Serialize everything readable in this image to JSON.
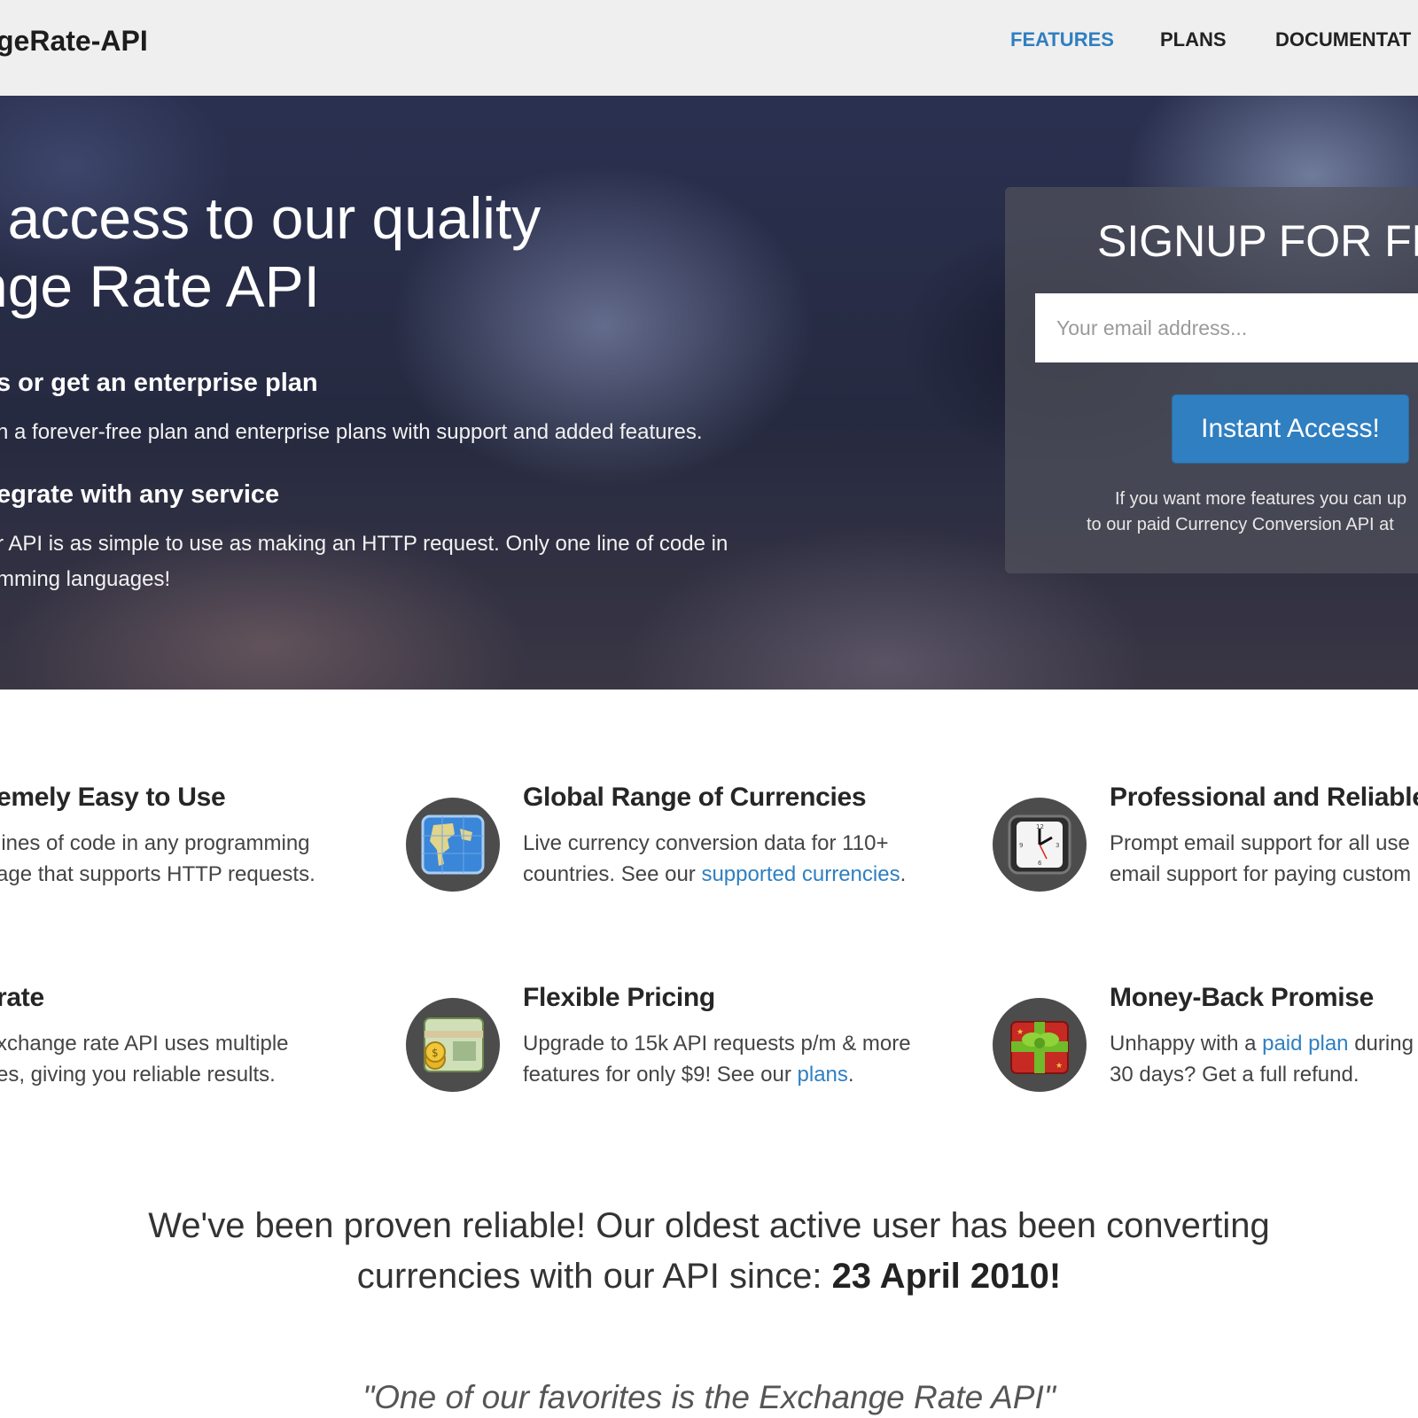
{
  "nav": {
    "brand": "geRate-API",
    "items": [
      {
        "label": "FEATURES",
        "active": true
      },
      {
        "label": "PLANS",
        "active": false
      },
      {
        "label": "DOCUMENTAT",
        "active": false
      }
    ]
  },
  "hero": {
    "title_line1": "t access to our quality",
    "title_line2": "nge Rate API",
    "h3_1": "s or get an enterprise plan",
    "p_1": "n a forever-free plan and enterprise plans with support and added features.",
    "h3_2": "egrate with any service",
    "p_2_line1": "r API is as simple to use as making an HTTP request. Only one line of code in",
    "p_2_line2": "mming languages!"
  },
  "signup": {
    "title": "SIGNUP FOR FR",
    "email_placeholder": "Your email address...",
    "button_label": "Instant Access!",
    "note_line1": "If you want more features you can up",
    "note_line2": "to our paid Currency Conversion API at"
  },
  "features": [
    {
      "title": "emely Easy to Use",
      "line1": "lines of code in any programming",
      "line2": "age that supports HTTP requests.",
      "icon": "easy-icon"
    },
    {
      "title": "Global Range of Currencies",
      "line1": "Live currency conversion data for 110+",
      "line2_pre": "countries. See our ",
      "line2_link": "supported currencies",
      "line2_post": ".",
      "icon": "globe-map-icon"
    },
    {
      "title": "Professional and Reliable",
      "line1": "Prompt email support for all use",
      "line2": "email support for paying custom",
      "icon": "clock-icon"
    },
    {
      "title": "rate",
      "line1": "xchange rate API uses multiple",
      "line2": "es, giving you reliable results.",
      "icon": "accurate-icon"
    },
    {
      "title": "Flexible Pricing",
      "line1": "Upgrade to 15k API requests p/m & more",
      "line2_pre": "features for only $9! See our ",
      "line2_link": "plans",
      "line2_post": ".",
      "icon": "money-icon"
    },
    {
      "title": "Money-Back Promise",
      "line1_pre": "Unhappy with a ",
      "line1_link": "paid plan",
      "line1_post": " during",
      "line2": "30 days? Get a full refund.",
      "icon": "gift-icon"
    }
  ],
  "reliable": {
    "line1": "We've been proven reliable! Our oldest active user has been converting",
    "line2_pre": "currencies with our API since: ",
    "line2_date": "23 April 2010!"
  },
  "quote": "\"One of our favorites is the Exchange Rate API\"",
  "colors": {
    "accent": "#2f7fc1",
    "nav_bg": "#efefef"
  }
}
